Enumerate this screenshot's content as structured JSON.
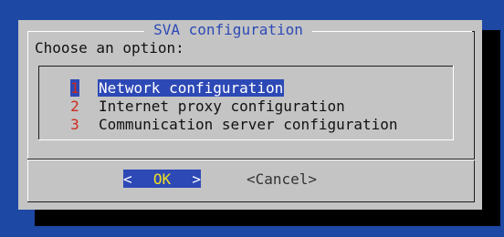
{
  "dialog": {
    "title": "SVA configuration",
    "prompt": "Choose an option:"
  },
  "menu": {
    "items": [
      {
        "key": "1",
        "label": "Network configuration",
        "selected": true
      },
      {
        "key": "2",
        "label": "Internet proxy configuration",
        "selected": false
      },
      {
        "key": "3",
        "label": "Communication server configuration",
        "selected": false
      }
    ]
  },
  "buttons": {
    "ok_left": "<",
    "ok_label": "OK",
    "ok_right": ">",
    "cancel_label": "<Cancel>"
  },
  "colors": {
    "background": "#1d48a4",
    "dialog": "#c4c4c4",
    "highlight": "#2d49b6",
    "hotkey": "#d0291b",
    "ok_text": "#f0e020"
  }
}
